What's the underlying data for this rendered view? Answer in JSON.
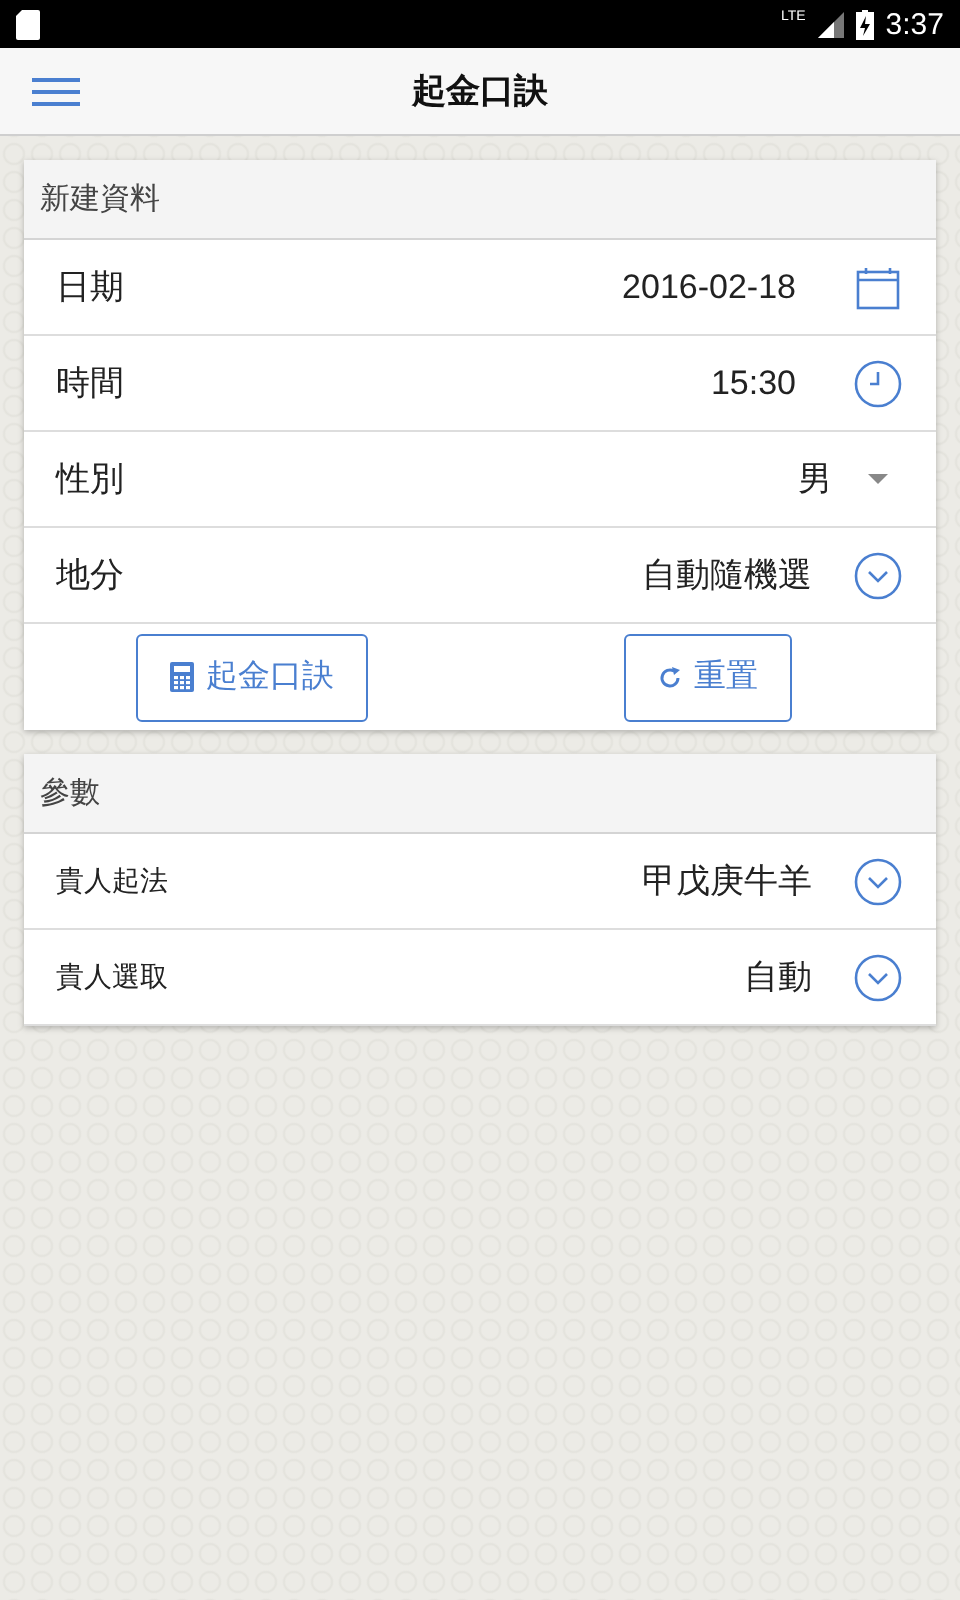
{
  "status_bar": {
    "network": "LTE",
    "time": "3:37"
  },
  "app_bar": {
    "title": "起金口訣"
  },
  "new_record": {
    "title": "新建資料",
    "fields": [
      {
        "kind": "date",
        "label": "日期",
        "value": "2016-02-18"
      },
      {
        "kind": "time",
        "label": "時間",
        "value": "15:30"
      },
      {
        "kind": "dropdown",
        "label": "性別",
        "value": "男"
      },
      {
        "kind": "select",
        "label": "地分",
        "value": "自動隨機選"
      }
    ],
    "buttons": [
      {
        "kind": "calculate",
        "label": "起金口訣"
      },
      {
        "kind": "reset",
        "label": "重置"
      }
    ]
  },
  "parameters": {
    "title": "參數",
    "fields": [
      {
        "kind": "select",
        "label": "貴人起法",
        "value": "甲戊庚牛羊"
      },
      {
        "kind": "select",
        "label": "貴人選取",
        "value": "自動"
      }
    ]
  }
}
